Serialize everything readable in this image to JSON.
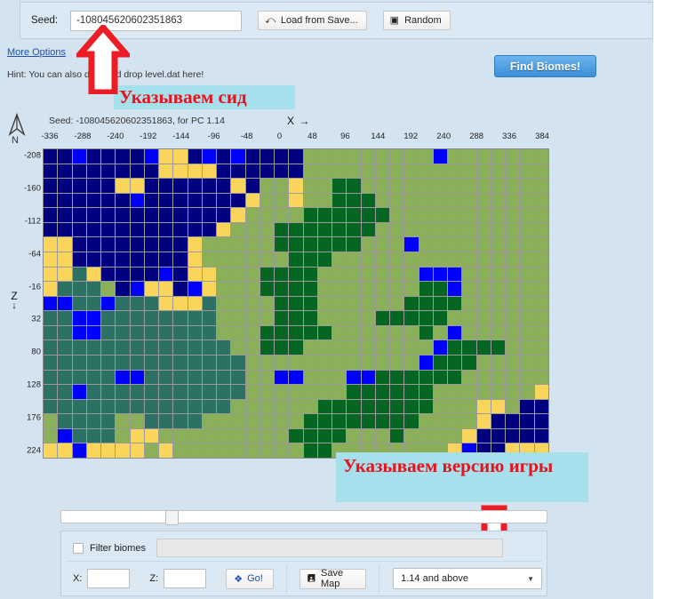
{
  "header": {
    "seed_label": "Seed:",
    "seed_value": "-108045620602351863",
    "load_from_save_label": "Load from Save...",
    "load_icon": "load-arrow-icon",
    "random_label": "Random",
    "random_icon": "dice-icon",
    "more_options_label": "More Options",
    "hint_text": "Hint: You can also drag and drop level.dat here!",
    "find_biomes_label": "Find Biomes!"
  },
  "annotations": [
    {
      "id": "seed-note",
      "text": "Указываем сид",
      "color": "#e8121a",
      "background": "#a6e0ec"
    },
    {
      "id": "version-note",
      "text": "Указываем версию игры",
      "color": "#e8121a",
      "background": "#a6e0ec"
    }
  ],
  "map": {
    "caption": "Seed: -108045620602351863, for PC 1.14",
    "compass_label": "N",
    "x_axis_label": "X →",
    "z_axis_label": "Z",
    "z_axis_arrow": "↓",
    "x_ticks": [
      "-336",
      "-288",
      "-240",
      "-192",
      "-144",
      "-96",
      "-48",
      "0",
      "48",
      "96",
      "144",
      "192",
      "240",
      "288",
      "336",
      "384"
    ],
    "z_ticks": [
      "-208",
      "-160",
      "-112",
      "-64",
      "-16",
      "32",
      "80",
      "128",
      "176",
      "224"
    ],
    "grid_cols": 35,
    "grid_rows": 21,
    "palette": {
      "ocean": "#000080",
      "deep_ocean": "#000033",
      "water": "#0000FF",
      "desert": "#FAD55C",
      "plains": "#8CB05A",
      "forest": "#056621",
      "dark_forest": "#2B4A17",
      "taiga": "#2C7164",
      "jungle": "#2D6A31"
    },
    "rows": [
      "OOWOOOOWDDOWOWOOOOPPPPPPPPPWPPPPPPP",
      "OOOOOOOODDDDOOOOOOPPPPPPPPPPPPPPPPP",
      "OOOOODDOOOOOODOPPDPPFFPPPPPPPPPPPPP",
      "OOOOOOWOOOOOOODPPDPPFFFPPPPPPPPPPPP",
      "OOOOOOOOOOOOODPPPPFFFFFFPPPPPPPPPPP",
      "OOOOOOOOOOOODPPPFFFFFFFPPPPPPPPPPPP",
      "DDOOOOOOOODPPPPPFFFFFFPPPWPPPPPPPPP",
      "DDOOOOOOOODPPPPPPFFFPPPPPPPPPPPPPPP",
      "DDTDOOOOWODDPPPFFFFPPPPPPPWWWPPPPPP",
      "DTTTPOWDDOWDPPPFFFFPPPPPPPFFWPPPPPP",
      "WWTTWTTTDDDTPPPPFFFPPPPPPFFFFPPPPPP",
      "TTWWTTTTTTTTPPPPFFFPPPPFFFFFPPPPPPP",
      "TTWWTTTTTTTTPPPFFFFFPPPPPPFPWPPPPPP",
      "TTTTTTTTTTTTTPPFFFPPPPPPPPPWFFFFPPP",
      "TTTTTTTTTTTTTTPPPPPPPPPPPPWFFFPPPPP",
      "TTTTTWWTTTTTTTPPWWPPPWWFFFFFFPPPPPP",
      "TTWTTTTTTTTTTTPPPPPPPFFFFFFPPPPPPPD",
      "TTTTTTTTTTTTTPPPPPPFFFFFFFFPPPDDPOO",
      "PTTTTPPTTTTPPPPPPPFFFFFFFFPPPPDOOOO",
      "PWTTTPDDPPPPPPPPPFFFFPPPFPPPPDOOOOO",
      "DDWDDDDPDPPPPPPPPPFFPPPPPPPPDWOODDD"
    ]
  },
  "footer": {
    "slider_value": 22,
    "filter_biomes_label": "Filter biomes",
    "filter_biomes_checked": false,
    "filter_biomes_input_value": "",
    "x_label": "X:",
    "x_value": "",
    "z_label": "Z:",
    "z_value": "",
    "go_label": "Go!",
    "go_icon": "pin-icon",
    "save_map_label": "Save Map",
    "save_map_icon": "save-disk-icon",
    "version_selected": "1.14 and above",
    "version_caret": "▼"
  }
}
